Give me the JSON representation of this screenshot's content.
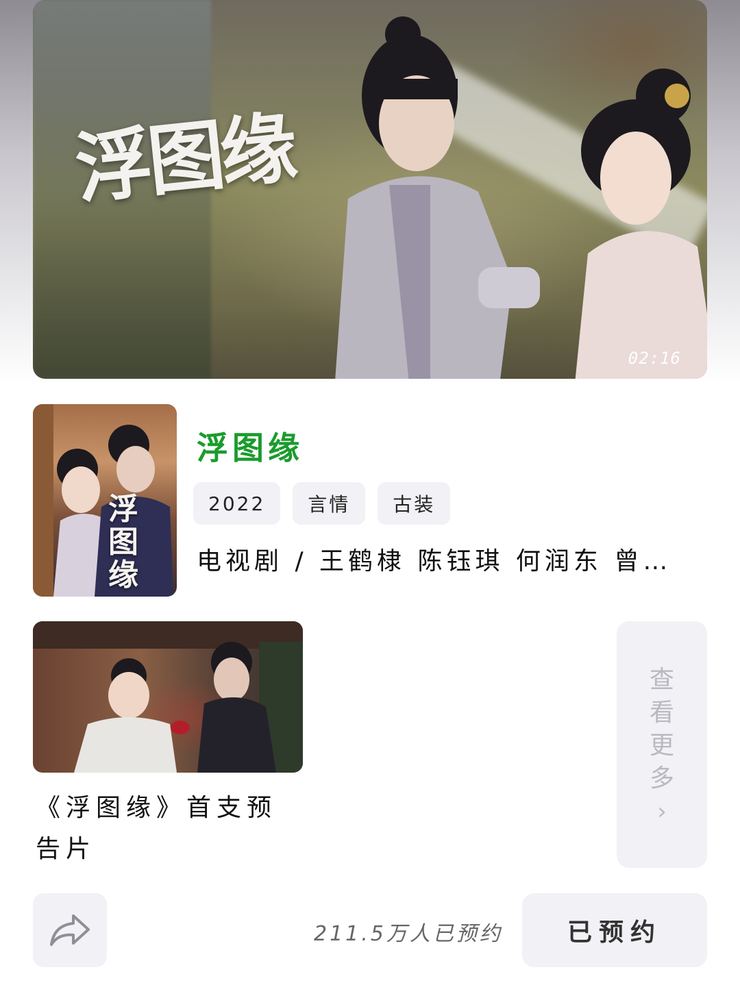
{
  "hero": {
    "title_art": "浮图缘",
    "duration": "02:16"
  },
  "show": {
    "title": "浮图缘",
    "poster_art": "浮图缘",
    "tags": [
      "2022",
      "言情",
      "古装"
    ],
    "meta": "电视剧 / 王鹤棣 陈钰琪 何润东 曾…"
  },
  "trailer": {
    "title": "《浮图缘》首支预告片"
  },
  "see_more": {
    "label": "查看更多",
    "chevron": "›"
  },
  "footer": {
    "reserve_count": "211.5万人已预约",
    "reserved_label": "已预约"
  },
  "colors": {
    "accent_green": "#1a9b2c",
    "chip_bg": "#f1f1f6",
    "muted_text": "#b9b9c0"
  },
  "icons": [
    "share-icon",
    "chevron-right-icon"
  ]
}
